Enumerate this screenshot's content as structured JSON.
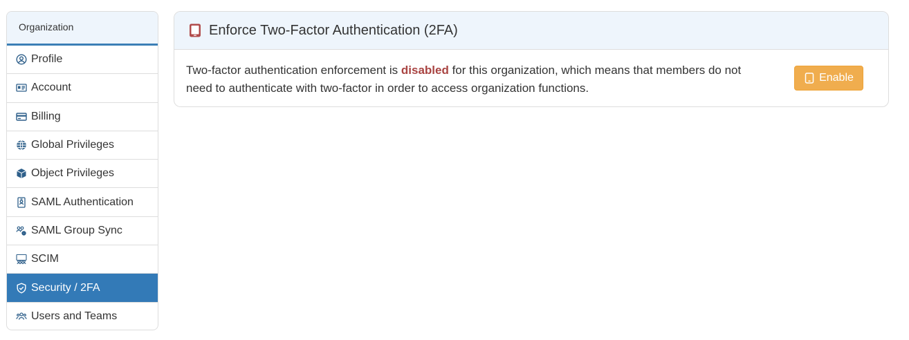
{
  "sidebar": {
    "header": "Organization",
    "items": [
      {
        "label": "Profile",
        "icon": "user-circle-icon",
        "active": false
      },
      {
        "label": "Account",
        "icon": "id-card-icon",
        "active": false
      },
      {
        "label": "Billing",
        "icon": "credit-card-icon",
        "active": false
      },
      {
        "label": "Global Privileges",
        "icon": "globe-icon",
        "active": false
      },
      {
        "label": "Object Privileges",
        "icon": "cube-icon",
        "active": false
      },
      {
        "label": "SAML Authentication",
        "icon": "id-badge-icon",
        "active": false
      },
      {
        "label": "SAML Group Sync",
        "icon": "users-cog-icon",
        "active": false
      },
      {
        "label": "SCIM",
        "icon": "people-group-icon",
        "active": false
      },
      {
        "label": "Security / 2FA",
        "icon": "shield-check-icon",
        "active": true
      },
      {
        "label": "Users and Teams",
        "icon": "users-icon",
        "active": false
      }
    ]
  },
  "panel": {
    "title": "Enforce Two-Factor Authentication (2FA)",
    "title_icon": "tablet-icon",
    "text_before": "Two-factor authentication enforcement is ",
    "status_word": "disabled",
    "text_after": " for this organization, which means that members do not need to authenticate with two-factor in order to access organization functions.",
    "enable_button": {
      "label": "Enable",
      "icon": "tablet-icon"
    }
  },
  "colors": {
    "active_bg": "#337ab7",
    "header_bg": "#eef5fc",
    "warning_button": "#f0ad4e",
    "danger_text": "#a94442",
    "tablet_icon": "#b14b4b"
  }
}
